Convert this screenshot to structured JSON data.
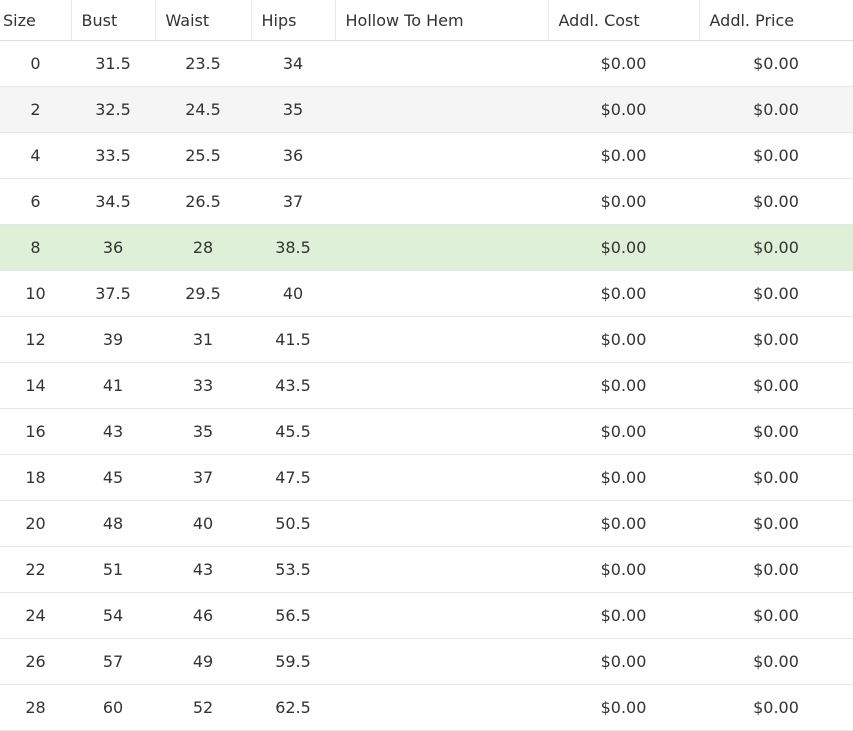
{
  "table": {
    "columns": [
      "Size",
      "Bust",
      "Waist",
      "Hips",
      "Hollow To Hem",
      "Addl. Cost",
      "Addl. Price"
    ],
    "rows": [
      {
        "size": "0",
        "bust": "31.5",
        "waist": "23.5",
        "hips": "34",
        "hollow_to_hem": "",
        "addl_cost": "$0.00",
        "addl_price": "$0.00",
        "style": "normal"
      },
      {
        "size": "2",
        "bust": "32.5",
        "waist": "24.5",
        "hips": "35",
        "hollow_to_hem": "",
        "addl_cost": "$0.00",
        "addl_price": "$0.00",
        "style": "alt"
      },
      {
        "size": "4",
        "bust": "33.5",
        "waist": "25.5",
        "hips": "36",
        "hollow_to_hem": "",
        "addl_cost": "$0.00",
        "addl_price": "$0.00",
        "style": "normal"
      },
      {
        "size": "6",
        "bust": "34.5",
        "waist": "26.5",
        "hips": "37",
        "hollow_to_hem": "",
        "addl_cost": "$0.00",
        "addl_price": "$0.00",
        "style": "normal"
      },
      {
        "size": "8",
        "bust": "36",
        "waist": "28",
        "hips": "38.5",
        "hollow_to_hem": "",
        "addl_cost": "$0.00",
        "addl_price": "$0.00",
        "style": "selected"
      },
      {
        "size": "10",
        "bust": "37.5",
        "waist": "29.5",
        "hips": "40",
        "hollow_to_hem": "",
        "addl_cost": "$0.00",
        "addl_price": "$0.00",
        "style": "normal"
      },
      {
        "size": "12",
        "bust": "39",
        "waist": "31",
        "hips": "41.5",
        "hollow_to_hem": "",
        "addl_cost": "$0.00",
        "addl_price": "$0.00",
        "style": "normal"
      },
      {
        "size": "14",
        "bust": "41",
        "waist": "33",
        "hips": "43.5",
        "hollow_to_hem": "",
        "addl_cost": "$0.00",
        "addl_price": "$0.00",
        "style": "normal"
      },
      {
        "size": "16",
        "bust": "43",
        "waist": "35",
        "hips": "45.5",
        "hollow_to_hem": "",
        "addl_cost": "$0.00",
        "addl_price": "$0.00",
        "style": "normal"
      },
      {
        "size": "18",
        "bust": "45",
        "waist": "37",
        "hips": "47.5",
        "hollow_to_hem": "",
        "addl_cost": "$0.00",
        "addl_price": "$0.00",
        "style": "normal"
      },
      {
        "size": "20",
        "bust": "48",
        "waist": "40",
        "hips": "50.5",
        "hollow_to_hem": "",
        "addl_cost": "$0.00",
        "addl_price": "$0.00",
        "style": "normal"
      },
      {
        "size": "22",
        "bust": "51",
        "waist": "43",
        "hips": "53.5",
        "hollow_to_hem": "",
        "addl_cost": "$0.00",
        "addl_price": "$0.00",
        "style": "normal"
      },
      {
        "size": "24",
        "bust": "54",
        "waist": "46",
        "hips": "56.5",
        "hollow_to_hem": "",
        "addl_cost": "$0.00",
        "addl_price": "$0.00",
        "style": "normal"
      },
      {
        "size": "26",
        "bust": "57",
        "waist": "49",
        "hips": "59.5",
        "hollow_to_hem": "",
        "addl_cost": "$0.00",
        "addl_price": "$0.00",
        "style": "normal"
      },
      {
        "size": "28",
        "bust": "60",
        "waist": "52",
        "hips": "62.5",
        "hollow_to_hem": "",
        "addl_cost": "$0.00",
        "addl_price": "$0.00",
        "style": "normal"
      }
    ]
  },
  "colors": {
    "selected_row": "#dff0d8",
    "alt_row": "#f5f5f5",
    "text": "#333333",
    "border": "#e6e6e6"
  }
}
